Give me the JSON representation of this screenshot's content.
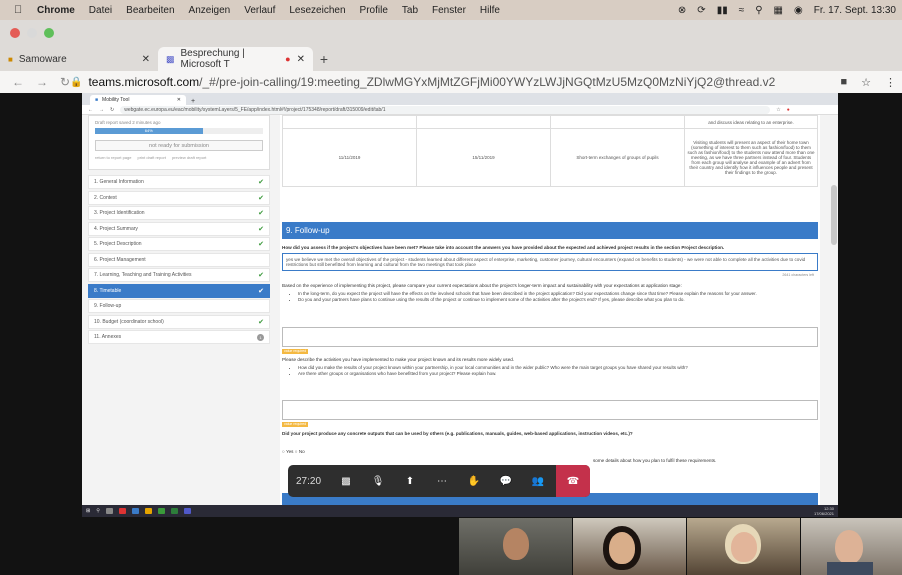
{
  "macbar": {
    "app": "Chrome",
    "menus": [
      "Datei",
      "Bearbeiten",
      "Anzeigen",
      "Verlauf",
      "Lesezeichen",
      "Profile",
      "Tab",
      "Fenster",
      "Hilfe"
    ],
    "datetime": "Fr. 17. Sept.  13:30"
  },
  "browser": {
    "tabs": [
      {
        "title": "Samoware"
      },
      {
        "title": "Besprechung | Microsoft T"
      }
    ],
    "url_host": "teams.microsoft.com",
    "url_path": "/_#/pre-join-calling/19:meeting_ZDlwMGYxMjMtZGFjMi00YWYzLWJjNGQtMzU5MzQ0MzNiYjQ2@thread.v2"
  },
  "inner_browser": {
    "tab": "Mobility Tool",
    "url": "webgate.ec.europa.eu/eac/mobility/systemLayers/5_FE/app/index.html#!/project/175348/report/draft/315009/edit/tab/1"
  },
  "sidebar": {
    "saved": "Draft report saved 2 minutes ago",
    "progress_label": "64%",
    "progress_value": 0.64,
    "status_button": "not ready for submission",
    "links": [
      "return to report page",
      "print draft report",
      "preview draft report"
    ],
    "items": [
      {
        "label": "1. General Information",
        "state": "done"
      },
      {
        "label": "2. Context",
        "state": "done"
      },
      {
        "label": "3. Project Identification",
        "state": "done"
      },
      {
        "label": "4. Project Summary",
        "state": "done"
      },
      {
        "label": "5. Project Description",
        "state": "done"
      },
      {
        "label": "6. Project Management",
        "state": "none"
      },
      {
        "label": "7. Learning, Teaching and Training Activities",
        "state": "done"
      },
      {
        "label": "8. Timetable",
        "state": "selected"
      },
      {
        "label": "9. Follow-up",
        "state": "none"
      },
      {
        "label": "10. Budget (coordinator school)",
        "state": "done"
      },
      {
        "label": "11. Annexes",
        "state": "badge",
        "badge": "1"
      }
    ]
  },
  "table": {
    "top_text": "and discuss ideas relating to an enterprise.",
    "row": {
      "start": "11/11/2019",
      "end": "15/11/2019",
      "activity": "Short-term exchanges of groups of pupils",
      "description": "Visiting students will present an aspect of their home town (something of interest to them such as fashion/food) to them such as fashion/food) to the students now attend more than one meeting, as we have three partners instead of four. Students from each group will analyse and example of an advert from their country and identify how it influences people and present their findings to the group."
    }
  },
  "followup": {
    "title": "9. Follow-up",
    "q1": "How did you assess if the project's objectives have been met? Please take into account the answers you have provided about the expected and achieved project results in the section Project description.",
    "a1": "yes we believe we met the overall objectives of the project - students learned about different aspect of enterprise, marketing, customer journey, cultural encounters (expand on benefits to students) - we were not able to complete all the activities due to covid restrictions but still benefitted from learning and cultural from the two meetings that took place",
    "chars_left": "2641 characters left",
    "q2": "Based on the experience of implementing this project, please compare your current expectations about the project's longer-term impact and sustainability with your expectations at application stage:",
    "q2_b1": "In the long-term, do you expect the project will have the effects on the involved schools that have been described in the project application? Did your expectations change since that time? Please explain the reasons for your answer.",
    "q2_b2": "Do you and your partners have plans to continue using the results of the project or continue to implement some of the activities after the project's end? If yes, please describe what you plan to do.",
    "value_required": "value required",
    "q3": "Please describe the activities you have implemented to make your project known and its results more widely used.",
    "q3_b1": "How did you make the results of your project known within your partnership, in your local communities and in the wider public? Who were the main target groups you have shared your results with?",
    "q3_b2": "Are there other groups or organisations who have benefitted from your project? Please explain how.",
    "q4": "Did your project produce any concrete outputs that can be used by others (e.g. publications, manuals, guides, web-based applications, instruction videos, etc.)?",
    "yes": "Yes",
    "no": "No",
    "q4_tail": "some details about how you plan to fulfil these requirements."
  },
  "call": {
    "timer": "27:20"
  },
  "taskbar": {
    "time": "12:30",
    "date": "17/06/2021"
  }
}
